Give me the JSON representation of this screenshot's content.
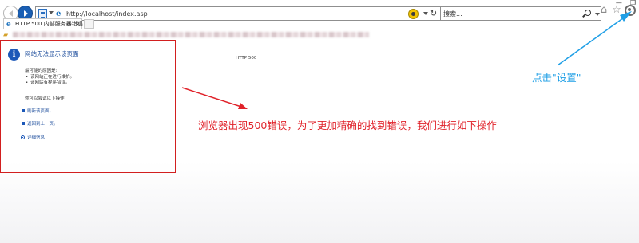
{
  "window": {
    "minimize": "—",
    "restore": "❐"
  },
  "address_bar": {
    "url": "http://localhost/index.asp",
    "refresh_glyph": "↻",
    "compat_label": "e"
  },
  "search": {
    "placeholder": "搜索..."
  },
  "toolbar_icons": [
    "home-icon",
    "favorites-star-icon",
    "gear-icon"
  ],
  "toolbar_glyphs": {
    "home": "⌂",
    "star": "☆"
  },
  "tab": {
    "icon": "e",
    "title": "HTTP 500 内部服务器错误",
    "close": "×"
  },
  "error_page": {
    "title": "网站无法显示该页面",
    "http_code": "HTTP 500",
    "causes_heading": "最可能的原因是:",
    "causes": [
      "该网站正在进行维护。",
      "该网站有程序错误。"
    ],
    "try_heading": "你可以尝试以下操作:",
    "actions": [
      "刷新该页面。",
      "返回到上一页。",
      "详细信息"
    ],
    "info_glyph": "i"
  },
  "annotations": {
    "main": "浏览器出现500错误，为了更加精确的找到错误，我们进行如下操作",
    "settings": "点击\"设置\""
  },
  "colors": {
    "annotation_red": "#e0222a",
    "annotation_blue": "#1f9fe6",
    "error_box_border": "#d21f1f",
    "link_blue": "#1e4e9c"
  }
}
